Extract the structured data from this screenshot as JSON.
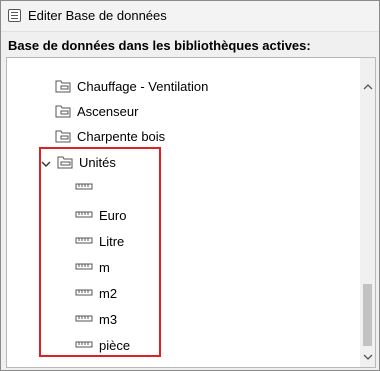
{
  "window": {
    "title": "Editer Base de données"
  },
  "section": {
    "label": "Base de données dans les bibliothèques actives:"
  },
  "tree": {
    "folders": [
      {
        "label": "Chauffage - Ventilation"
      },
      {
        "label": "Ascenseur"
      },
      {
        "label": "Charpente bois"
      }
    ],
    "expanded": {
      "label": "Unités",
      "children": [
        {
          "label": ""
        },
        {
          "label": "Euro"
        },
        {
          "label": "Litre"
        },
        {
          "label": "m"
        },
        {
          "label": "m2"
        },
        {
          "label": "m3"
        },
        {
          "label": "pièce"
        }
      ]
    }
  },
  "icons": {
    "app": "database-icon",
    "folder": "folder-icon",
    "unit": "ruler-icon",
    "expand": "chevron-down-icon"
  },
  "colors": {
    "highlight": "#e02020"
  }
}
